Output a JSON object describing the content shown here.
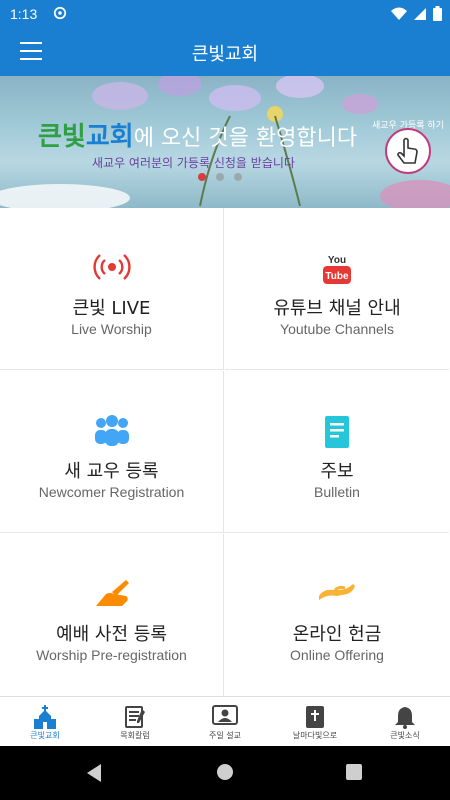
{
  "status_bar": {
    "time": "1:13"
  },
  "app_bar": {
    "title": "큰빛교회"
  },
  "banner": {
    "brand_part1": "큰빛",
    "brand_part2": "교회",
    "headline_rest": "에 오신 것을 환영합니다",
    "subtitle": "새교우 여러분의 가등록 신청을 받습니다",
    "touch_label": "새교우 가등록 하기",
    "active_slide": 1,
    "slide_count": 3
  },
  "tiles": [
    {
      "ko": "큰빛 LIVE",
      "en": "Live Worship",
      "icon": "live-broadcast-icon"
    },
    {
      "ko": "유튜브 채널 안내",
      "en": "Youtube Channels",
      "icon": "youtube-icon",
      "icon_text": "You",
      "icon_text2": "Tube"
    },
    {
      "ko": "새 교우 등록",
      "en": "Newcomer Registration",
      "icon": "people-group-icon"
    },
    {
      "ko": "주보",
      "en": "Bulletin",
      "icon": "bulletin-document-icon"
    },
    {
      "ko": "예배 사전 등록",
      "en": "Worship Pre-registration",
      "icon": "writing-hand-icon"
    },
    {
      "ko": "온라인 헌금",
      "en": "Online Offering",
      "icon": "giving-hand-icon"
    }
  ],
  "bottom_nav": [
    {
      "label": "큰빛교회",
      "icon": "church-icon",
      "active": true
    },
    {
      "label": "목회칼럼",
      "icon": "column-writing-icon",
      "active": false
    },
    {
      "label": "주일 설교",
      "icon": "sermon-video-icon",
      "active": false
    },
    {
      "label": "날마다빛으로",
      "icon": "bible-icon",
      "active": false
    },
    {
      "label": "큰빛소식",
      "icon": "bell-icon",
      "active": false
    }
  ],
  "colors": {
    "primary": "#1b7fd1",
    "live_red": "#e53935",
    "youtube_red": "#e53935",
    "people_blue": "#42a5f5",
    "bulletin_cyan": "#26c6da",
    "orange": "#fb8c00",
    "offering_yellow": "#f9b233"
  }
}
